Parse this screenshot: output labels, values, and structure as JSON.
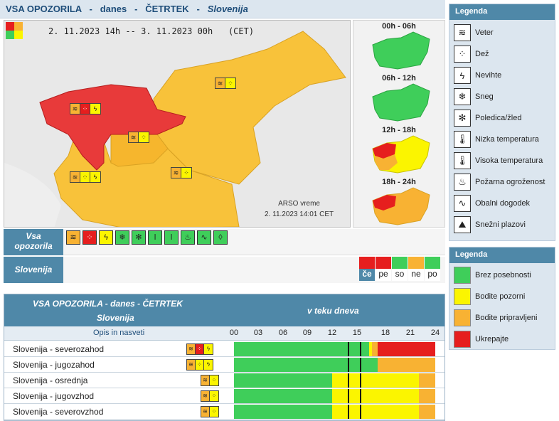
{
  "header": {
    "part1": "VSA OPOZORILA",
    "sep1": "-",
    "part2": "danes",
    "sep2": "-",
    "part3": "ČETRTEK",
    "sep3": "-",
    "part4": "Slovenija"
  },
  "map": {
    "date_from": "2. 11.2023",
    "time_from": "14h",
    "arrow": "--",
    "date_to": "3. 11.2023",
    "time_to": "00h",
    "tz": "(CET)",
    "credit": "ARSO vreme",
    "stamp": "2. 11.2023 14:01 CET"
  },
  "mini_maps": [
    {
      "label": "00h - 06h"
    },
    {
      "label": "06h - 12h"
    },
    {
      "label": "12h - 18h"
    },
    {
      "label": "18h - 24h"
    }
  ],
  "legend_types": {
    "title": "Legenda",
    "items": [
      {
        "label": "Veter",
        "icon": "wind-icon"
      },
      {
        "label": "Dež",
        "icon": "rain-icon"
      },
      {
        "label": "Nevihte",
        "icon": "thunderstorm-icon"
      },
      {
        "label": "Sneg",
        "icon": "snow-icon"
      },
      {
        "label": "Poledica/žled",
        "icon": "ice-icon"
      },
      {
        "label": "Nizka temperatura",
        "icon": "low-temperature-icon"
      },
      {
        "label": "Visoka temperatura",
        "icon": "high-temperature-icon"
      },
      {
        "label": "Požarna ogroženost",
        "icon": "fire-icon"
      },
      {
        "label": "Obalni dogodek",
        "icon": "coastal-icon"
      },
      {
        "label": "Snežni plazovi",
        "icon": "avalanche-icon"
      }
    ]
  },
  "legend_levels": {
    "title": "Legenda",
    "items": [
      {
        "label": "Brez posebnosti",
        "color": "#3fce5a"
      },
      {
        "label": "Bodite pozorni",
        "color": "#fbf500"
      },
      {
        "label": "Bodite pripravljeni",
        "color": "#f8b233"
      },
      {
        "label": "Ukrepajte",
        "color": "#e61e1e"
      }
    ]
  },
  "typebar": {
    "label_line1": "Vsa",
    "label_line2": "opozorila"
  },
  "regionbar": {
    "label": "Slovenija",
    "days": [
      {
        "label": "če",
        "color": "#e61e1e",
        "selected": true
      },
      {
        "label": "pe",
        "color": "#e61e1e"
      },
      {
        "label": "so",
        "color": "#3fce5a"
      },
      {
        "label": "ne",
        "color": "#f8b233"
      },
      {
        "label": "po",
        "color": "#3fce5a"
      }
    ]
  },
  "table": {
    "title_line1": "VSA OPOZORILA - danes - ČETRTEK",
    "title_line2": "Slovenija",
    "title_right": "v teku dneva",
    "subhead": "Opis in nasveti",
    "hours": [
      "00",
      "03",
      "06",
      "09",
      "12",
      "15",
      "18",
      "21",
      "24"
    ],
    "rows": [
      {
        "name": "Slovenija - severozahod"
      },
      {
        "name": "Slovenija - jugozahod"
      },
      {
        "name": "Slovenija - osrednja"
      },
      {
        "name": "Slovenija - jugovzhod"
      },
      {
        "name": "Slovenija - severovzhod"
      }
    ]
  },
  "colors": {
    "green": "#3fce5a",
    "yellow": "#fbf500",
    "orange": "#f8b233",
    "red": "#e61e1e",
    "accent": "#4f88a8"
  }
}
